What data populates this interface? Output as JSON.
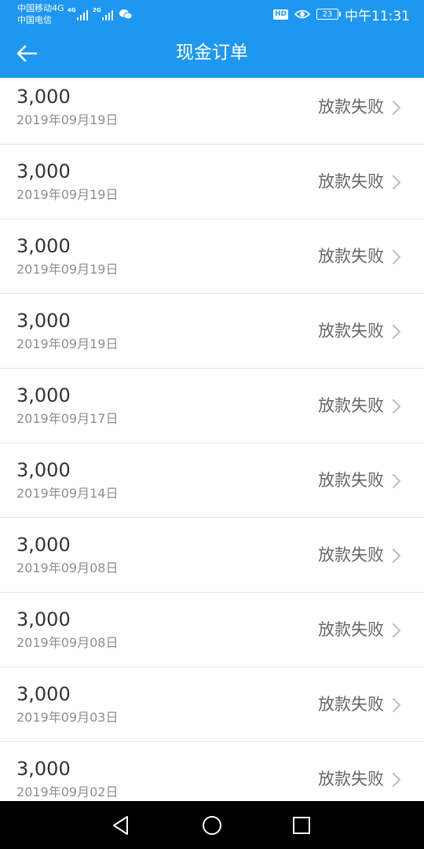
{
  "status_bar": {
    "carrier_1": "中国移动4G",
    "carrier_2": "中国电信",
    "signal_1_tag": "4G",
    "signal_2_tag": "2G",
    "hd_label": "HD",
    "battery_level": "23",
    "time": "中午11:31"
  },
  "header": {
    "title": "现金订单",
    "back_icon": "arrow-left-icon"
  },
  "orders": [
    {
      "amount": "3,000",
      "date": "2019年09月19日",
      "status": "放款失败"
    },
    {
      "amount": "3,000",
      "date": "2019年09月19日",
      "status": "放款失败"
    },
    {
      "amount": "3,000",
      "date": "2019年09月19日",
      "status": "放款失败"
    },
    {
      "amount": "3,000",
      "date": "2019年09月19日",
      "status": "放款失败"
    },
    {
      "amount": "3,000",
      "date": "2019年09月17日",
      "status": "放款失败"
    },
    {
      "amount": "3,000",
      "date": "2019年09月14日",
      "status": "放款失败"
    },
    {
      "amount": "3,000",
      "date": "2019年09月08日",
      "status": "放款失败"
    },
    {
      "amount": "3,000",
      "date": "2019年09月08日",
      "status": "放款失败"
    },
    {
      "amount": "3,000",
      "date": "2019年09月03日",
      "status": "放款失败"
    },
    {
      "amount": "3,000",
      "date": "2019年09月02日",
      "status": "放款失败"
    }
  ],
  "navigation": {
    "back": "triangle-back-icon",
    "home": "circle-home-icon",
    "recents": "square-recents-icon"
  },
  "colors": {
    "primary": "#1e97f0",
    "amount_text": "#333333",
    "date_text": "#8e8e8e",
    "status_text": "#666666",
    "divider": "#e4e4e4",
    "nav_bar": "#000000"
  }
}
